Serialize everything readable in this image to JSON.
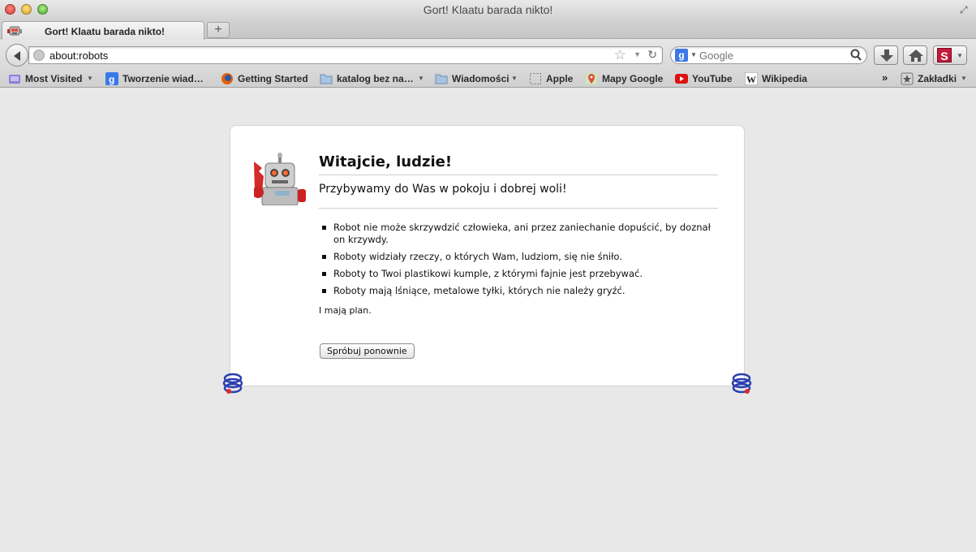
{
  "window": {
    "title": "Gort! Klaatu barada nikto!"
  },
  "tabs": [
    {
      "label": "Gort! Klaatu barada nikto!"
    }
  ],
  "navbar": {
    "url": "about:robots",
    "search_placeholder": "Google",
    "search_engine_glyph": "g"
  },
  "bookmarks": {
    "items": [
      {
        "label": "Most Visited",
        "icon": "most-visited-icon"
      },
      {
        "label": "Tworzenie wiad…",
        "icon": "google-icon"
      },
      {
        "label": "Getting Started",
        "icon": "firefox-icon"
      },
      {
        "label": "katalog bez na…",
        "icon": "folder-icon"
      },
      {
        "label": "Wiadomości",
        "icon": "folder-icon"
      },
      {
        "label": "Apple",
        "icon": "apple-icon"
      },
      {
        "label": "Mapy Google",
        "icon": "maps-icon"
      },
      {
        "label": "YouTube",
        "icon": "youtube-icon"
      },
      {
        "label": "Wikipedia",
        "icon": "wikipedia-icon"
      }
    ],
    "menu_label": "Zakładki"
  },
  "page": {
    "heading": "Witajcie, ludzie!",
    "subheading": "Przybywamy do Was w pokoju i dobrej woli!",
    "laws": [
      "Robot nie może skrzywdzić człowieka, ani przez zaniechanie dopuścić, by doznał on krzywdy.",
      "Roboty widziały rzeczy, o których Wam, ludziom, się nie śniło.",
      "Roboty to Twoi plastikowi kumple, z którymi fajnie jest przebywać.",
      "Roboty mają lśniące, metalowe tyłki, których nie należy gryźć."
    ],
    "plan": "I mają plan.",
    "retry_button": "Spróbuj ponownie"
  },
  "colors": {
    "content_bg": "#e8e8e8",
    "card_bg": "#ffffff"
  }
}
